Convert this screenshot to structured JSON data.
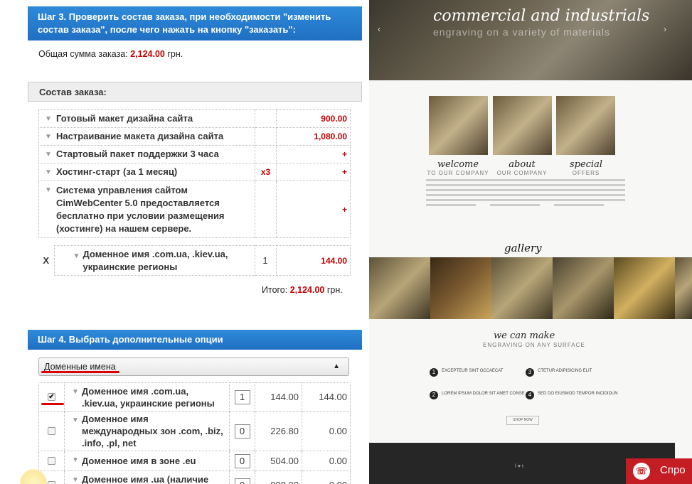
{
  "step3": {
    "title": "Шаг 3. Проверить состав заказа, при необходимости \"изменить состав заказа\", после чего нажать на кнопку \"заказать\":"
  },
  "total": {
    "label": "Общая сумма заказа:",
    "amount": "2,124.00",
    "currency": "грн."
  },
  "composition": {
    "title": "Состав заказа:"
  },
  "order_items": [
    {
      "name": "Готовый макет дизайна сайта",
      "qty": "",
      "price": "900.00"
    },
    {
      "name": "Настраивание макета дизайна сайта",
      "qty": "",
      "price": "1,080.00"
    },
    {
      "name": "Стартовый пакет поддержки 3 часа",
      "qty": "",
      "price": "+"
    },
    {
      "name": "Хостинг-старт (за 1 месяц)",
      "qty": "x3",
      "price": "+"
    },
    {
      "name": "Система управления сайтом CimWebCenter 5.0 предоставляется бесплатно при условии размещения (хостинге) на нашем сервере.",
      "qty": "",
      "price": "+"
    }
  ],
  "domain_item": {
    "remove": "X",
    "name": "Доменное имя .com.ua, .kiev.ua, украинские регионы",
    "qty": "1",
    "price": "144.00"
  },
  "itogo": {
    "label": "Итого:",
    "amount": "2,124.00",
    "currency": "грн."
  },
  "step4": {
    "title": "Шаг 4. Выбрать дополнительные опции"
  },
  "select": {
    "value": "Доменные имена"
  },
  "options": [
    {
      "name": "Доменное имя .com.ua, .kiev.ua, украинские регионы",
      "checked": true,
      "qty": "1",
      "price": "144.00",
      "sum": "144.00"
    },
    {
      "name": "Доменное имя международных зон .com, .biz, .info, .pl, net",
      "checked": false,
      "qty": "0",
      "price": "226.80",
      "sum": "0.00"
    },
    {
      "name": "Доменное имя в зоне .eu",
      "checked": false,
      "qty": "0",
      "price": "504.00",
      "sum": "0.00"
    },
    {
      "name": "Доменное имя .ua (наличие торговой марки обязательно)",
      "checked": false,
      "qty": "0",
      "price": "888.00",
      "sum": "0.00"
    }
  ],
  "preview": {
    "hero_title": "commercial and industrials",
    "hero_sub": "engraving on a variety of materials",
    "cols": [
      {
        "title": "welcome",
        "sub": "TO OUR COMPANY"
      },
      {
        "title": "about",
        "sub": "OUR COMPANY"
      },
      {
        "title": "special",
        "sub": "OFFERS"
      }
    ],
    "gallery": "gallery",
    "make_title": "we can make",
    "make_sub": "ENGRAVING ON ANY SURFACE",
    "bullets": [
      {
        "n": "1",
        "text": "EXCEPTEUR SINT OCCAECAT"
      },
      {
        "n": "2",
        "text": "LOREM IPSUM DOLOR SIT AMET CONSE"
      },
      {
        "n": "3",
        "text": "CTETUR ADIPISICING ELIT"
      },
      {
        "n": "4",
        "text": "SED DO EIUSMOD TEMPOR INCIDIDUN"
      }
    ],
    "shop": "SHOP NOW",
    "footer_social": "f ♥ t"
  },
  "chat": {
    "label": "Спро"
  },
  "colors": {
    "header_blue": "#1f6fc2",
    "price_red": "#c40000",
    "chat_red": "#c41e24"
  }
}
